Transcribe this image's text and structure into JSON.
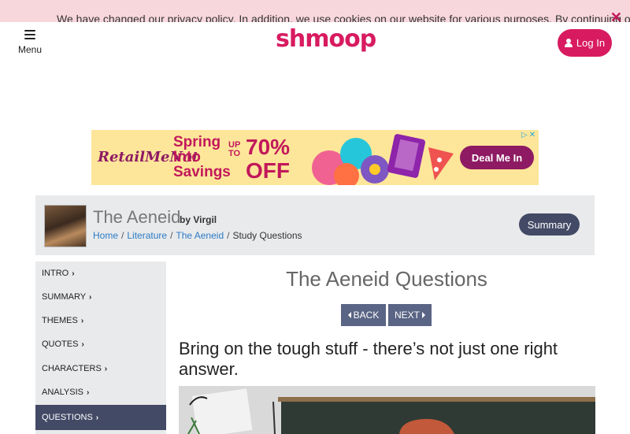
{
  "privacy_banner": {
    "text": "We have changed our privacy policy. In addition, we use cookies on our website for various purposes. By continuing on our",
    "close_symbol": "✕"
  },
  "header": {
    "menu_label": "Menu",
    "logo_text": "shmoop",
    "login_label": "Log In"
  },
  "ad": {
    "brand": "RetailMeNot",
    "headline_lines": [
      "Spring",
      "Into",
      "Savings"
    ],
    "up_to": [
      "UP",
      "TO"
    ],
    "discount": "70%",
    "off": "OFF",
    "cta": "Deal Me In"
  },
  "book": {
    "title": "The Aeneid",
    "author": "by Virgil",
    "breadcrumb": [
      "Home",
      "Literature",
      "The Aeneid",
      "Study Questions"
    ],
    "summary_button": "Summary"
  },
  "sidebar": {
    "items": [
      "INTRO",
      "SUMMARY",
      "THEMES",
      "QUOTES",
      "CHARACTERS",
      "ANALYSIS",
      "QUESTIONS"
    ],
    "active": "QUESTIONS"
  },
  "main": {
    "title": "The Aeneid Questions",
    "back_label": "BACK",
    "next_label": "NEXT",
    "lead": "Bring on the tough stuff - there’s not just one right answer."
  },
  "colors": {
    "brand_pink": "#d81b60",
    "nav_slate": "#434a66",
    "nav_button": "#5a6484",
    "panel_gray": "#e8eaec",
    "link_blue": "#2b7bc4",
    "ad_yellow": "#fde69a"
  }
}
